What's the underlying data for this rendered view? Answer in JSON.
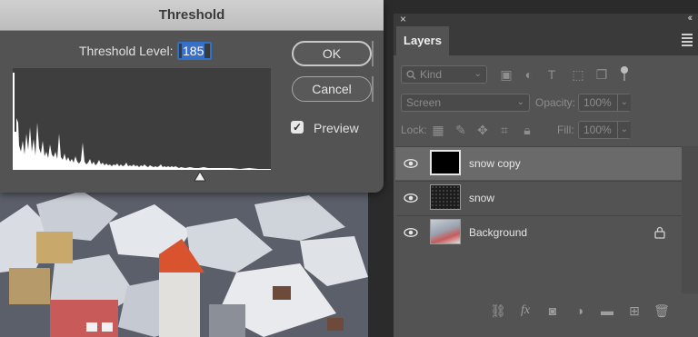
{
  "dialog": {
    "title": "Threshold",
    "level_label": "Threshold Level:",
    "level_value": "185",
    "ok_label": "OK",
    "cancel_label": "Cancel",
    "preview_label": "Preview",
    "preview_checked": true,
    "slider_level": 185,
    "slider_max": 255
  },
  "panel": {
    "close_glyph": "×",
    "collapse_glyph": "‹‹",
    "tab": "Layers",
    "filter": {
      "kind": "Kind"
    },
    "blend_mode": "Screen",
    "opacity_label": "Opacity:",
    "opacity_value": "100%",
    "lock_label": "Lock:",
    "fill_label": "Fill:",
    "fill_value": "100%",
    "layers": [
      {
        "name": "snow copy",
        "selected": true,
        "visible": true,
        "locked": false
      },
      {
        "name": "snow",
        "selected": false,
        "visible": true,
        "locked": false
      },
      {
        "name": "Background",
        "selected": false,
        "visible": true,
        "locked": true
      }
    ],
    "bottom_icons": [
      "link-icon",
      "fx-icon",
      "layer-mask-icon",
      "adjustment-layer-icon",
      "group-folder-icon",
      "new-layer-icon",
      "trash-icon"
    ],
    "fx_glyph": "fx"
  },
  "colors": {
    "accent": "#2f70c9",
    "panel_bg": "#535353",
    "selected_row": "#6a6a6a"
  }
}
